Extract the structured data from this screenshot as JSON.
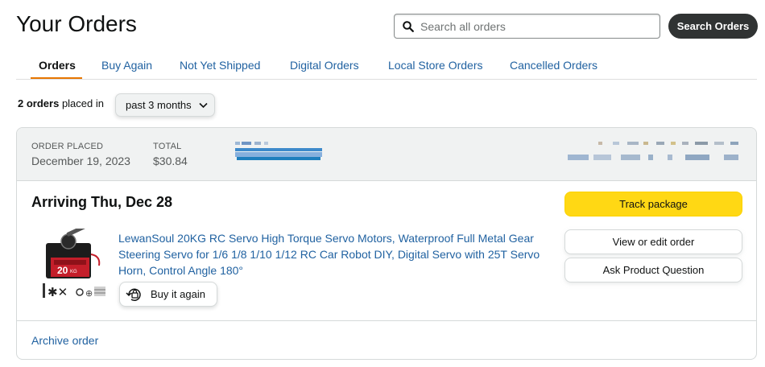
{
  "header": {
    "title": "Your Orders",
    "search_placeholder": "Search all orders",
    "search_button": "Search Orders"
  },
  "tabs": [
    {
      "label": "Orders",
      "active": true
    },
    {
      "label": "Buy Again",
      "active": false
    },
    {
      "label": "Not Yet Shipped",
      "active": false
    },
    {
      "label": "Digital Orders",
      "active": false
    },
    {
      "label": "Local Store Orders",
      "active": false
    },
    {
      "label": "Cancelled Orders",
      "active": false
    }
  ],
  "summary": {
    "count": "2 orders",
    "text": "placed in",
    "range": "past 3 months"
  },
  "order": {
    "placed_label": "ORDER PLACED",
    "placed_value": "December 19, 2023",
    "total_label": "TOTAL",
    "total_value": "$30.84",
    "arriving": "Arriving Thu, Dec 28",
    "product_title": "LewanSoul 20KG RC Servo High Torque Servo Motors, Waterproof Full Metal Gear Steering Servo for 1/6 1/8 1/10 1/12 RC Car Robot DIY, Digital Servo with 25T Servo Horn, Control Angle 180°",
    "buy_again": "Buy it again",
    "track": "Track package",
    "view_edit": "View or edit order",
    "ask": "Ask Product Question",
    "archive": "Archive order"
  },
  "colors": {
    "link": "#2162a1",
    "tab_underline": "#e77600",
    "track_button": "#ffd814",
    "search_button": "#303333"
  }
}
